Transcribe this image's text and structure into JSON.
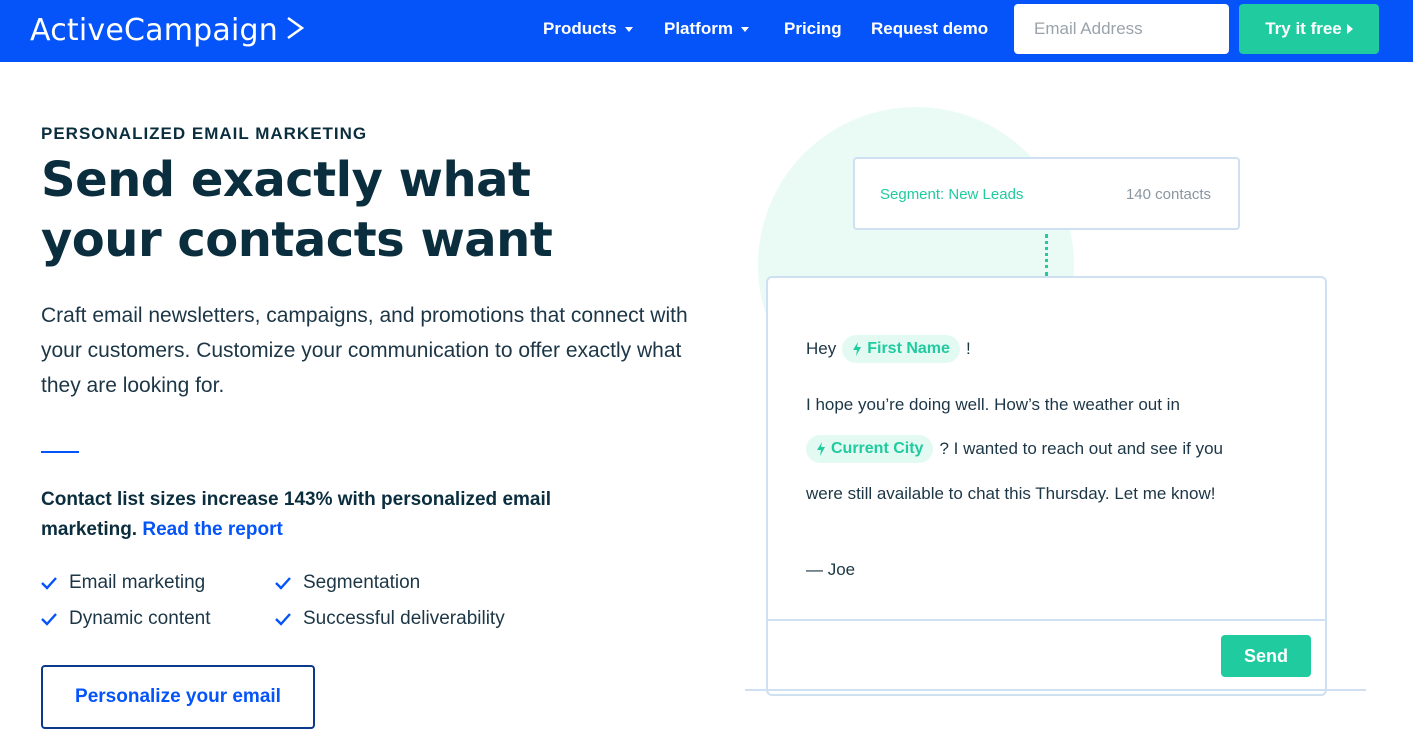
{
  "header": {
    "logo_text": "ActiveCampaign",
    "nav": {
      "products": "Products",
      "platform": "Platform",
      "pricing": "Pricing",
      "request_demo": "Request demo"
    },
    "email_placeholder": "Email Address",
    "try_label": "Try it free"
  },
  "hero": {
    "eyebrow": "PERSONALIZED EMAIL MARKETING",
    "headline": "Send exactly what your contacts want",
    "lede": "Craft email newsletters, campaigns, and promotions that connect with your customers. Customize your communication to offer exactly what they are looking for.",
    "stat_text": "Contact list sizes increase 143% with personalized email marketing.",
    "stat_link": "Read the report",
    "features": [
      "Email marketing",
      "Segmentation",
      "Dynamic content",
      "Successful deliverability"
    ],
    "cta_label": "Personalize your email"
  },
  "illustration": {
    "segment_label": "Segment: New Leads",
    "segment_count": "140 contacts",
    "greeting": "Hey",
    "first_name_tag": "First Name",
    "exclaim": "!",
    "line1": "I hope you’re doing well. How’s the weather out in",
    "city_tag": "Current City",
    "line2": "? I wanted to reach out and see if you",
    "line3": "were still available to chat this Thursday. Let me know!",
    "signature": "— Joe",
    "send_label": "Send"
  },
  "colors": {
    "brand_blue": "#0554fa",
    "accent_green": "#1fcb9f",
    "navy": "#0b2e3f"
  },
  "icons": [
    "chevron-right-icon",
    "caret-down-icon",
    "play-arrow-icon",
    "check-icon",
    "bolt-icon"
  ]
}
